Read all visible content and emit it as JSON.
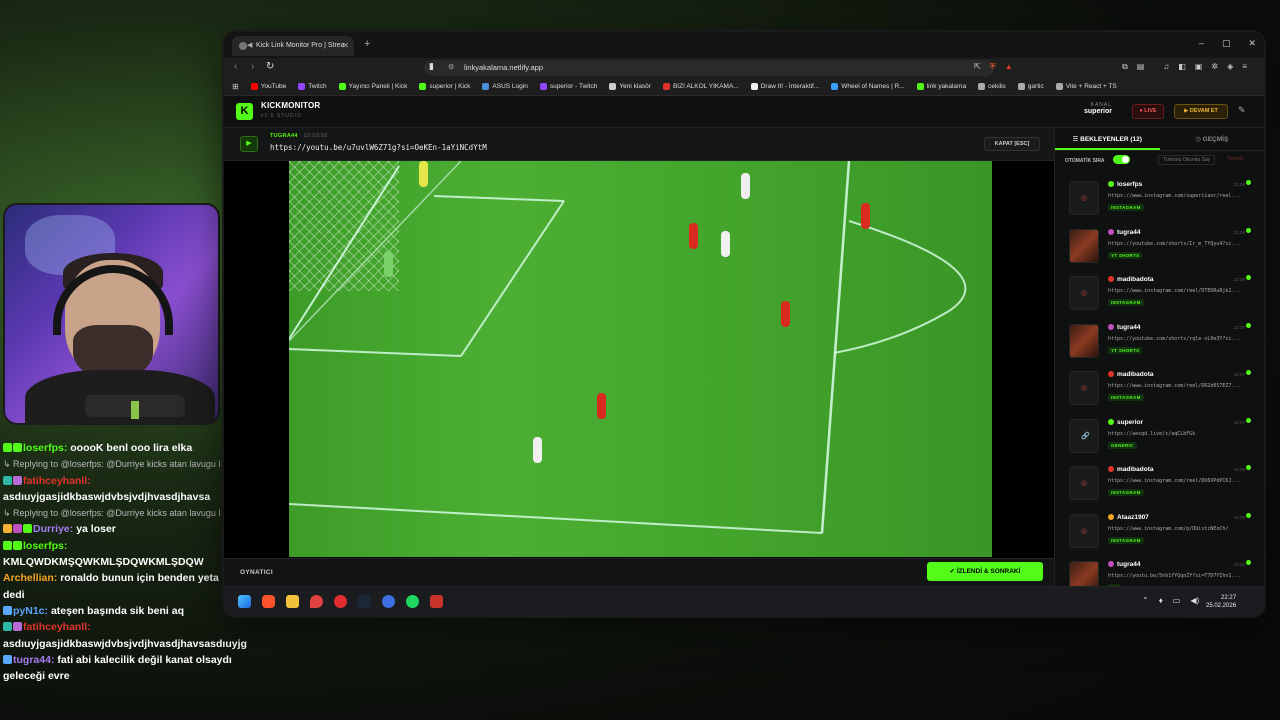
{
  "chat": [
    {
      "kind": "msg",
      "user": "loserfps:",
      "user_color": "#53fc18",
      "text": "ooooK benl ooo lira elka",
      "badges": [
        "#53fc18",
        "#53fc18"
      ]
    },
    {
      "kind": "reply",
      "text": "Replying to @loserfps: @Durriye kicks atan lavugu l"
    },
    {
      "kind": "msg",
      "user": "fatihceyhanll:",
      "user_color": "#e0332b",
      "text": "",
      "badges": [
        "#2fb6a6",
        "#b86bd6"
      ]
    },
    {
      "kind": "plain",
      "text": "asdıuyjgasjidkbaswjdvbsjvdjhvasdjhavsa"
    },
    {
      "kind": "reply",
      "text": "Replying to @loserfps: @Durriye kicks atan lavugu l"
    },
    {
      "kind": "msg",
      "user": "Durriye:",
      "user_color": "#a67cf2",
      "text": "ya loser",
      "badges": [
        "#f2b233",
        "#c24fc2",
        "#53fc18"
      ]
    },
    {
      "kind": "msg",
      "user": "loserfps:",
      "user_color": "#53fc18",
      "text": "",
      "badges": [
        "#53fc18",
        "#53fc18"
      ]
    },
    {
      "kind": "plain",
      "text": "KMLQWDKMŞQWKMLŞDQWKMLŞDQW"
    },
    {
      "kind": "msg",
      "user": "Archellian:",
      "user_color": "#f5a623",
      "text": "ronaldo bunun için benden yeta",
      "badges": []
    },
    {
      "kind": "plain",
      "text": "dedi"
    },
    {
      "kind": "msg",
      "user": "pyN1c:",
      "user_color": "#59a7ff",
      "text": "ateşen başında sik beni aq",
      "badges": [
        "#59a7ff"
      ]
    },
    {
      "kind": "msg",
      "user": "fatihceyhanll:",
      "user_color": "#e0332b",
      "text": "",
      "badges": [
        "#2fb6a6",
        "#b86bd6"
      ]
    },
    {
      "kind": "plain",
      "text": "asdıuyjgasjidkbaswjdvbsjvdjhvasdjhavsasdıuyjg"
    },
    {
      "kind": "msg",
      "user": "tugra44:",
      "user_color": "#a67cf2",
      "text": "fati abi kalecilik değil kanat olsaydı",
      "badges": [
        "#59a7ff"
      ]
    },
    {
      "kind": "plain",
      "text": "geleceği evre"
    }
  ],
  "browser": {
    "tab_title": "Kick Link Monitor Pro | Strea",
    "new_tab": "+",
    "window_controls": [
      "–",
      "▢",
      "✕"
    ],
    "url": "linkyakalama.netlify.app",
    "bookmarks": [
      {
        "label": "YouTube",
        "color": "#ff0000"
      },
      {
        "label": "Twitch",
        "color": "#9146ff"
      },
      {
        "label": "Yayıncı Paneli | Kick",
        "color": "#53fc18"
      },
      {
        "label": "superior | Kick",
        "color": "#53fc18"
      },
      {
        "label": "ASUS Login",
        "color": "#4a90d9"
      },
      {
        "label": "superior - Twitch",
        "color": "#9146ff"
      },
      {
        "label": "Yeni klasör",
        "color": "#cccccc"
      },
      {
        "label": "BIZI ALKOL YIKAMA...",
        "color": "#e0332b"
      },
      {
        "label": "Draw It! - İnteraktif...",
        "color": "#eeeeee"
      },
      {
        "label": "Wheel of Names | R...",
        "color": "#3aa0ff"
      },
      {
        "label": "link yakalama",
        "color": "#53fc18"
      },
      {
        "label": "cekilis",
        "color": "#aaaaaa"
      },
      {
        "label": "gartic",
        "color": "#aaaaaa"
      },
      {
        "label": "Vite + React + TS",
        "color": "#aaaaaa"
      }
    ]
  },
  "app": {
    "logo_letter": "K",
    "brand_a": "KICK",
    "brand_b": "MONITOR",
    "version": "v1.0 STUDIO",
    "kanal_label": "KANAL",
    "kanal_value": "superior",
    "live_label": "● LIVE",
    "devam_label": "▶ DEVAM ET",
    "current": {
      "sender": "TUGRA44",
      "time": "22:03:50",
      "url": "https://youtu.be/u7uvlW6Z71g?si=OeKEn-1aYiNCdYtM"
    },
    "kapat_label": "KAPAT [ESC]",
    "oynatici_label": "OYNATICI",
    "next_label": "✔ İZLENDİ & SONRAKİ",
    "tabs": {
      "waiting": "☰ BEKLEYENLER (12)",
      "history": "◷ GEÇMİŞ"
    },
    "auto_label": "OTOMATİK SIRA",
    "mark_all": "Tümünü Okundu Say",
    "clear": "Temizle",
    "queue": [
      {
        "name": "loserfps",
        "time": "22:09",
        "url": "https://www.instagram.com/superiiaor/reel...",
        "tag": "INSTAGRAM",
        "dot": "#53fc18",
        "thumb": "plain"
      },
      {
        "name": "tugra44",
        "time": "22:08",
        "url": "https://youtube.com/shorts/Ir_m_TYQyu4?si...",
        "tag": "YT SHORTS",
        "dot": "#c24fc2",
        "thumb": "img"
      },
      {
        "name": "madibadota",
        "time": "22:08",
        "url": "https://www.instagram.com/reel/DTEKRuRjk2...",
        "tag": "INSTAGRAM",
        "dot": "#e0332b",
        "thumb": "plain"
      },
      {
        "name": "tugra44",
        "time": "22:07",
        "url": "https://youtube.com/shorts/rqle-xL0e3Y?si...",
        "tag": "YT SHORTS",
        "dot": "#c24fc2",
        "thumb": "img"
      },
      {
        "name": "madibadota",
        "time": "22:07",
        "url": "https://www.instagram.com/reel/DR2d0S7EZ7...",
        "tag": "INSTAGRAM",
        "dot": "#e0332b",
        "thumb": "plain"
      },
      {
        "name": "superior",
        "time": "22:07",
        "url": "https://aesqd.live/c/aqCLbFGk",
        "tag": "GENERIC",
        "dot": "#53fc18",
        "thumb": "link"
      },
      {
        "name": "madibadota",
        "time": "22:06",
        "url": "https://www.instagram.com/reel/DU6VPdPCKJ...",
        "tag": "INSTAGRAM",
        "dot": "#e0332b",
        "thumb": "plain"
      },
      {
        "name": "Ataaz1907",
        "time": "22:05",
        "url": "https://www.instagram.com/p/DUistcNEoCh/",
        "tag": "INSTAGRAM",
        "dot": "#f5a623",
        "thumb": "plain"
      },
      {
        "name": "tugra44",
        "time": "22:04",
        "url": "https://youtu.be/5hh1fYQqnZY?si=T7D7YIhn1...",
        "tag": "YT",
        "dot": "#c24fc2",
        "thumb": "img"
      }
    ]
  },
  "taskbar": {
    "time": "22:27",
    "date": "25.02.2026"
  }
}
